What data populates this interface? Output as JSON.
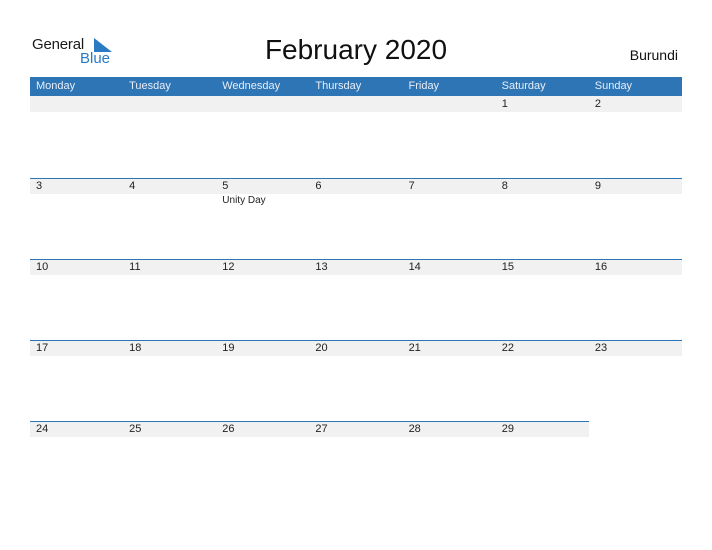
{
  "logo": {
    "word1": "General",
    "word2": "Blue"
  },
  "title": "February 2020",
  "country": "Burundi",
  "colors": {
    "accent": "#2e75b6",
    "date_strip": "#f1f1f1"
  },
  "weekdays": [
    "Monday",
    "Tuesday",
    "Wednesday",
    "Thursday",
    "Friday",
    "Saturday",
    "Sunday"
  ],
  "weeks": [
    {
      "days": [
        {
          "d": ""
        },
        {
          "d": ""
        },
        {
          "d": ""
        },
        {
          "d": ""
        },
        {
          "d": ""
        },
        {
          "d": "1"
        },
        {
          "d": "2"
        }
      ]
    },
    {
      "days": [
        {
          "d": "3"
        },
        {
          "d": "4"
        },
        {
          "d": "5",
          "holiday": "Unity Day"
        },
        {
          "d": "6"
        },
        {
          "d": "7"
        },
        {
          "d": "8"
        },
        {
          "d": "9"
        }
      ]
    },
    {
      "days": [
        {
          "d": "10"
        },
        {
          "d": "11"
        },
        {
          "d": "12"
        },
        {
          "d": "13"
        },
        {
          "d": "14"
        },
        {
          "d": "15"
        },
        {
          "d": "16"
        }
      ]
    },
    {
      "days": [
        {
          "d": "17"
        },
        {
          "d": "18"
        },
        {
          "d": "19"
        },
        {
          "d": "20"
        },
        {
          "d": "21"
        },
        {
          "d": "22"
        },
        {
          "d": "23"
        }
      ]
    },
    {
      "days": [
        {
          "d": "24"
        },
        {
          "d": "25"
        },
        {
          "d": "26"
        },
        {
          "d": "27"
        },
        {
          "d": "28"
        },
        {
          "d": "29"
        },
        {
          "d": ""
        }
      ]
    }
  ]
}
